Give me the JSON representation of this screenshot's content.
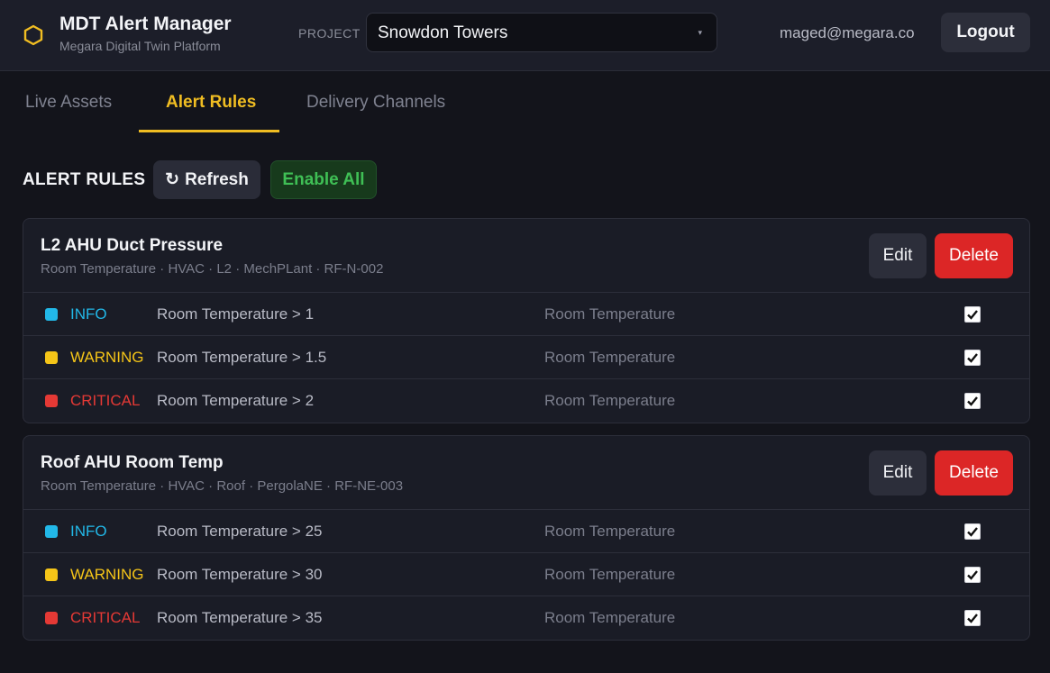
{
  "header": {
    "app_title": "MDT Alert Manager",
    "app_subtitle": "Megara Digital Twin Platform",
    "logo_icon": "hexagon-icon",
    "project_label": "PROJECT",
    "project_value": "Snowdon Towers",
    "caret": "▾",
    "user_email": "maged@megara.co",
    "logout_label": "Logout"
  },
  "tabs": [
    {
      "label": "Live Assets",
      "active": false
    },
    {
      "label": "Alert Rules",
      "active": true
    },
    {
      "label": "Delivery Channels",
      "active": false
    }
  ],
  "toolbar": {
    "title": "ALERT RULES",
    "refresh_icon": "↻",
    "refresh_label": "Refresh",
    "enable_all_label": "Enable All"
  },
  "colors": {
    "accent": "#f0bd22",
    "info": "#22b8e8",
    "warning": "#f5c518",
    "critical": "#e53935",
    "delete": "#dc2626",
    "enable_text": "#3fbf55"
  },
  "rules": [
    {
      "name": "L2 AHU Duct Pressure",
      "meta": "Room Temperature · HVAC · L2 · MechPLant · RF-N-002",
      "edit_label": "Edit",
      "delete_label": "Delete",
      "levels": [
        {
          "level": "INFO",
          "condition": "Room Temperature > 1",
          "metric": "Room Temperature",
          "enabled": true
        },
        {
          "level": "WARNING",
          "condition": "Room Temperature > 1.5",
          "metric": "Room Temperature",
          "enabled": true
        },
        {
          "level": "CRITICAL",
          "condition": "Room Temperature > 2",
          "metric": "Room Temperature",
          "enabled": true
        }
      ]
    },
    {
      "name": "Roof AHU Room Temp",
      "meta": "Room Temperature · HVAC · Roof · PergolaNE · RF-NE-003",
      "edit_label": "Edit",
      "delete_label": "Delete",
      "levels": [
        {
          "level": "INFO",
          "condition": "Room Temperature > 25",
          "metric": "Room Temperature",
          "enabled": true
        },
        {
          "level": "WARNING",
          "condition": "Room Temperature > 30",
          "metric": "Room Temperature",
          "enabled": true
        },
        {
          "level": "CRITICAL",
          "condition": "Room Temperature > 35",
          "metric": "Room Temperature",
          "enabled": true
        }
      ]
    }
  ]
}
